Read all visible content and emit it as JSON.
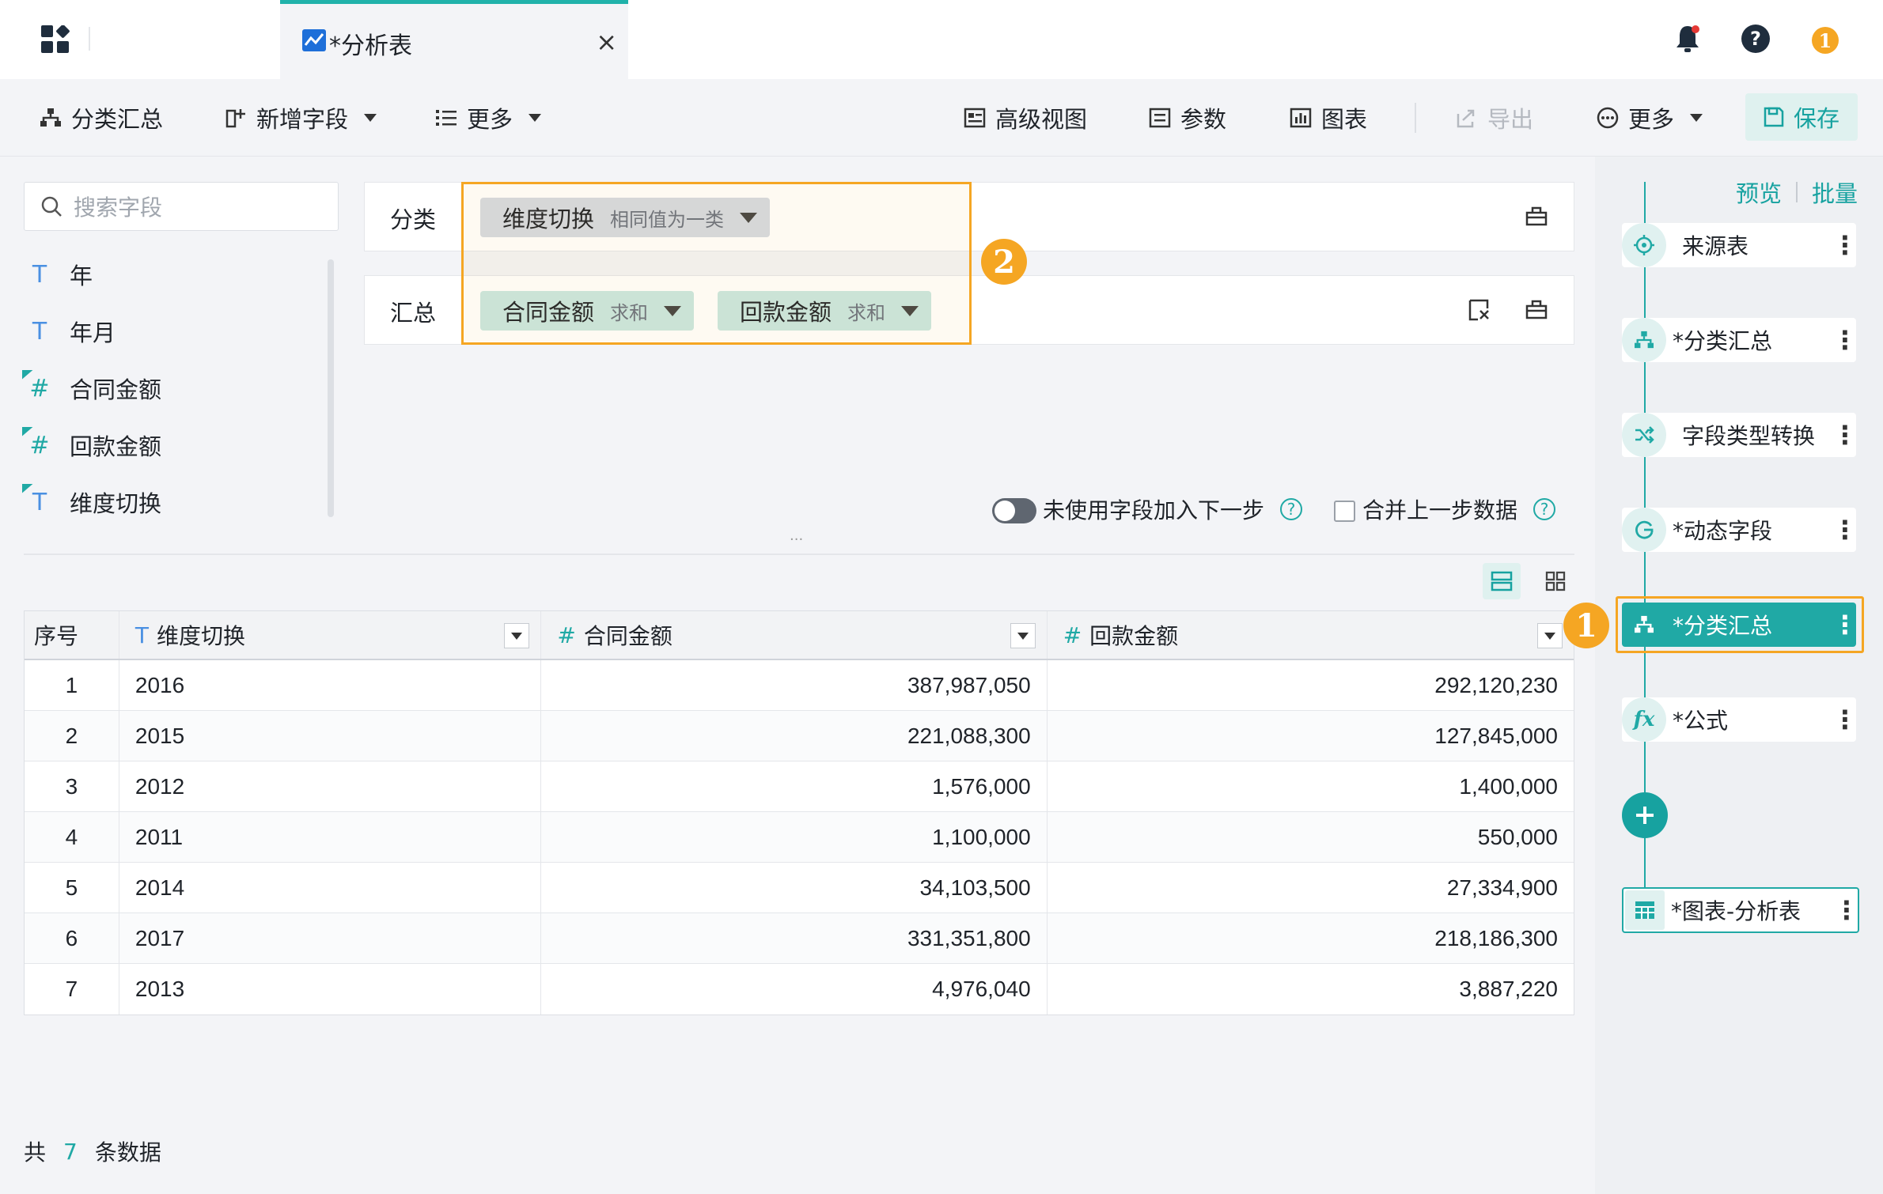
{
  "tab": {
    "title": "*分析表",
    "close": "×"
  },
  "header": {
    "alert_count": "1"
  },
  "toolbar": {
    "group_summary": "分类汇总",
    "add_field": "新增字段",
    "more_left": "更多",
    "advanced_view": "高级视图",
    "params": "参数",
    "chart": "图表",
    "export": "导出",
    "more_right": "更多",
    "save": "保存"
  },
  "fields": {
    "search_placeholder": "搜索字段",
    "items": [
      {
        "label": "年",
        "type": "T"
      },
      {
        "label": "年月",
        "type": "T"
      },
      {
        "label": "合同金额",
        "type": "#"
      },
      {
        "label": "回款金额",
        "type": "#"
      },
      {
        "label": "维度切换",
        "type": "T"
      }
    ]
  },
  "config": {
    "group_label": "分类",
    "group_chip": {
      "name": "维度切换",
      "mode": "相同值为一类"
    },
    "summary_label": "汇总",
    "summary_chips": [
      {
        "name": "合同金额",
        "agg": "求和"
      },
      {
        "name": "回款金额",
        "agg": "求和"
      }
    ],
    "badge2": "2",
    "unused_toggle_label": "未使用字段加入下一步",
    "merge_label": "合并上一步数据",
    "help": "?"
  },
  "table": {
    "headers": [
      {
        "label": "序号"
      },
      {
        "label": "维度切换",
        "type": "T"
      },
      {
        "label": "合同金额",
        "type": "#"
      },
      {
        "label": "回款金额",
        "type": "#"
      }
    ],
    "rows": [
      [
        "1",
        "2016",
        "387,987,050",
        "292,120,230"
      ],
      [
        "2",
        "2015",
        "221,088,300",
        "127,845,000"
      ],
      [
        "3",
        "2012",
        "1,576,000",
        "1,400,000"
      ],
      [
        "4",
        "2011",
        "1,100,000",
        "550,000"
      ],
      [
        "5",
        "2014",
        "34,103,500",
        "27,334,900"
      ],
      [
        "6",
        "2017",
        "331,351,800",
        "218,186,300"
      ],
      [
        "7",
        "2013",
        "4,976,040",
        "3,887,220"
      ]
    ]
  },
  "footer": {
    "prefix": "共",
    "count": "7",
    "suffix": "条数据"
  },
  "workflow": {
    "preview": "预览",
    "batch": "批量",
    "badge1": "1",
    "steps": [
      {
        "label": "来源表",
        "icon": "source-icon"
      },
      {
        "label": "*分类汇总",
        "icon": "group-icon"
      },
      {
        "label": "字段类型转换",
        "icon": "shuffle-icon"
      },
      {
        "label": "*动态字段",
        "icon": "dynamic-icon"
      },
      {
        "label": "*分类汇总",
        "icon": "group-icon",
        "active": true
      },
      {
        "label": "*公式",
        "icon": "formula-icon"
      },
      {
        "label": "*图表-分析表",
        "icon": "table-icon"
      }
    ]
  },
  "colors": {
    "accent": "#20a9a5",
    "highlight": "#f5a623"
  }
}
